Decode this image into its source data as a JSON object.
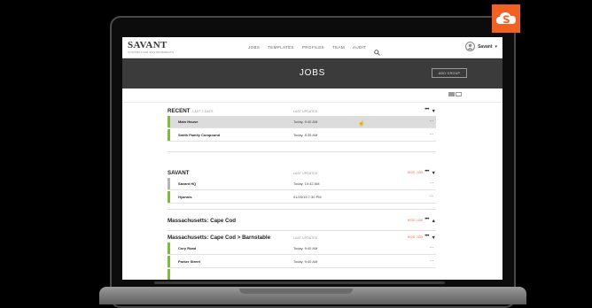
{
  "brand": {
    "name": "SAVANT",
    "subtitle": "CONTROLLED ENVIRONMENTS"
  },
  "nav": {
    "items": [
      "JOBS",
      "TEMPLATES",
      "PROFILES",
      "TEAM",
      "AUDIT"
    ]
  },
  "user": {
    "name": "Savant"
  },
  "page": {
    "title": "JOBS",
    "add_group_label": "ADD GROUP"
  },
  "columns": {
    "last_updated": "LAST UPDATED"
  },
  "groups": [
    {
      "title": "RECENT",
      "sub": "LAST 7 DAYS",
      "hide_label": "",
      "rows": [
        {
          "name": "Main House",
          "time": "Today, 9:40 AM"
        },
        {
          "name": "Smith Family Compound",
          "time": "Today, 8:35 AM"
        }
      ]
    },
    {
      "title": "SAVANT",
      "sub": "",
      "hide_label": "HIDE JOB",
      "rows": [
        {
          "name": "Savant HQ",
          "time": "Today, 10:42 AM"
        },
        {
          "name": "Hyannis",
          "time": "01/25/19 7:30 PM"
        }
      ]
    },
    {
      "title": "Massachusetts: Cape Cod",
      "sub": "",
      "hide_label": "HIDE JOB",
      "rows": []
    },
    {
      "title": "Massachusetts: Cape Cod > Barnstable",
      "sub": "",
      "hide_label": "HIDE JOB",
      "rows": [
        {
          "name": "Cory Road",
          "time": "Today, 9:40 AM"
        },
        {
          "name": "Parker Street",
          "time": "Today, 9:40 AM"
        },
        {
          "name": "",
          "time": ""
        }
      ]
    }
  ],
  "row_menu_glyph": "...",
  "group_menu_glyph": "•••",
  "colors": {
    "accent": "#f26122",
    "active_bar": "#7dbb3a",
    "inactive_bar": "#b4b4b4",
    "header_bg": "#3b3b3b"
  },
  "icons": {
    "search": "search-icon",
    "cloud": "savant-cloud-icon",
    "avatar": "avatar-icon"
  }
}
